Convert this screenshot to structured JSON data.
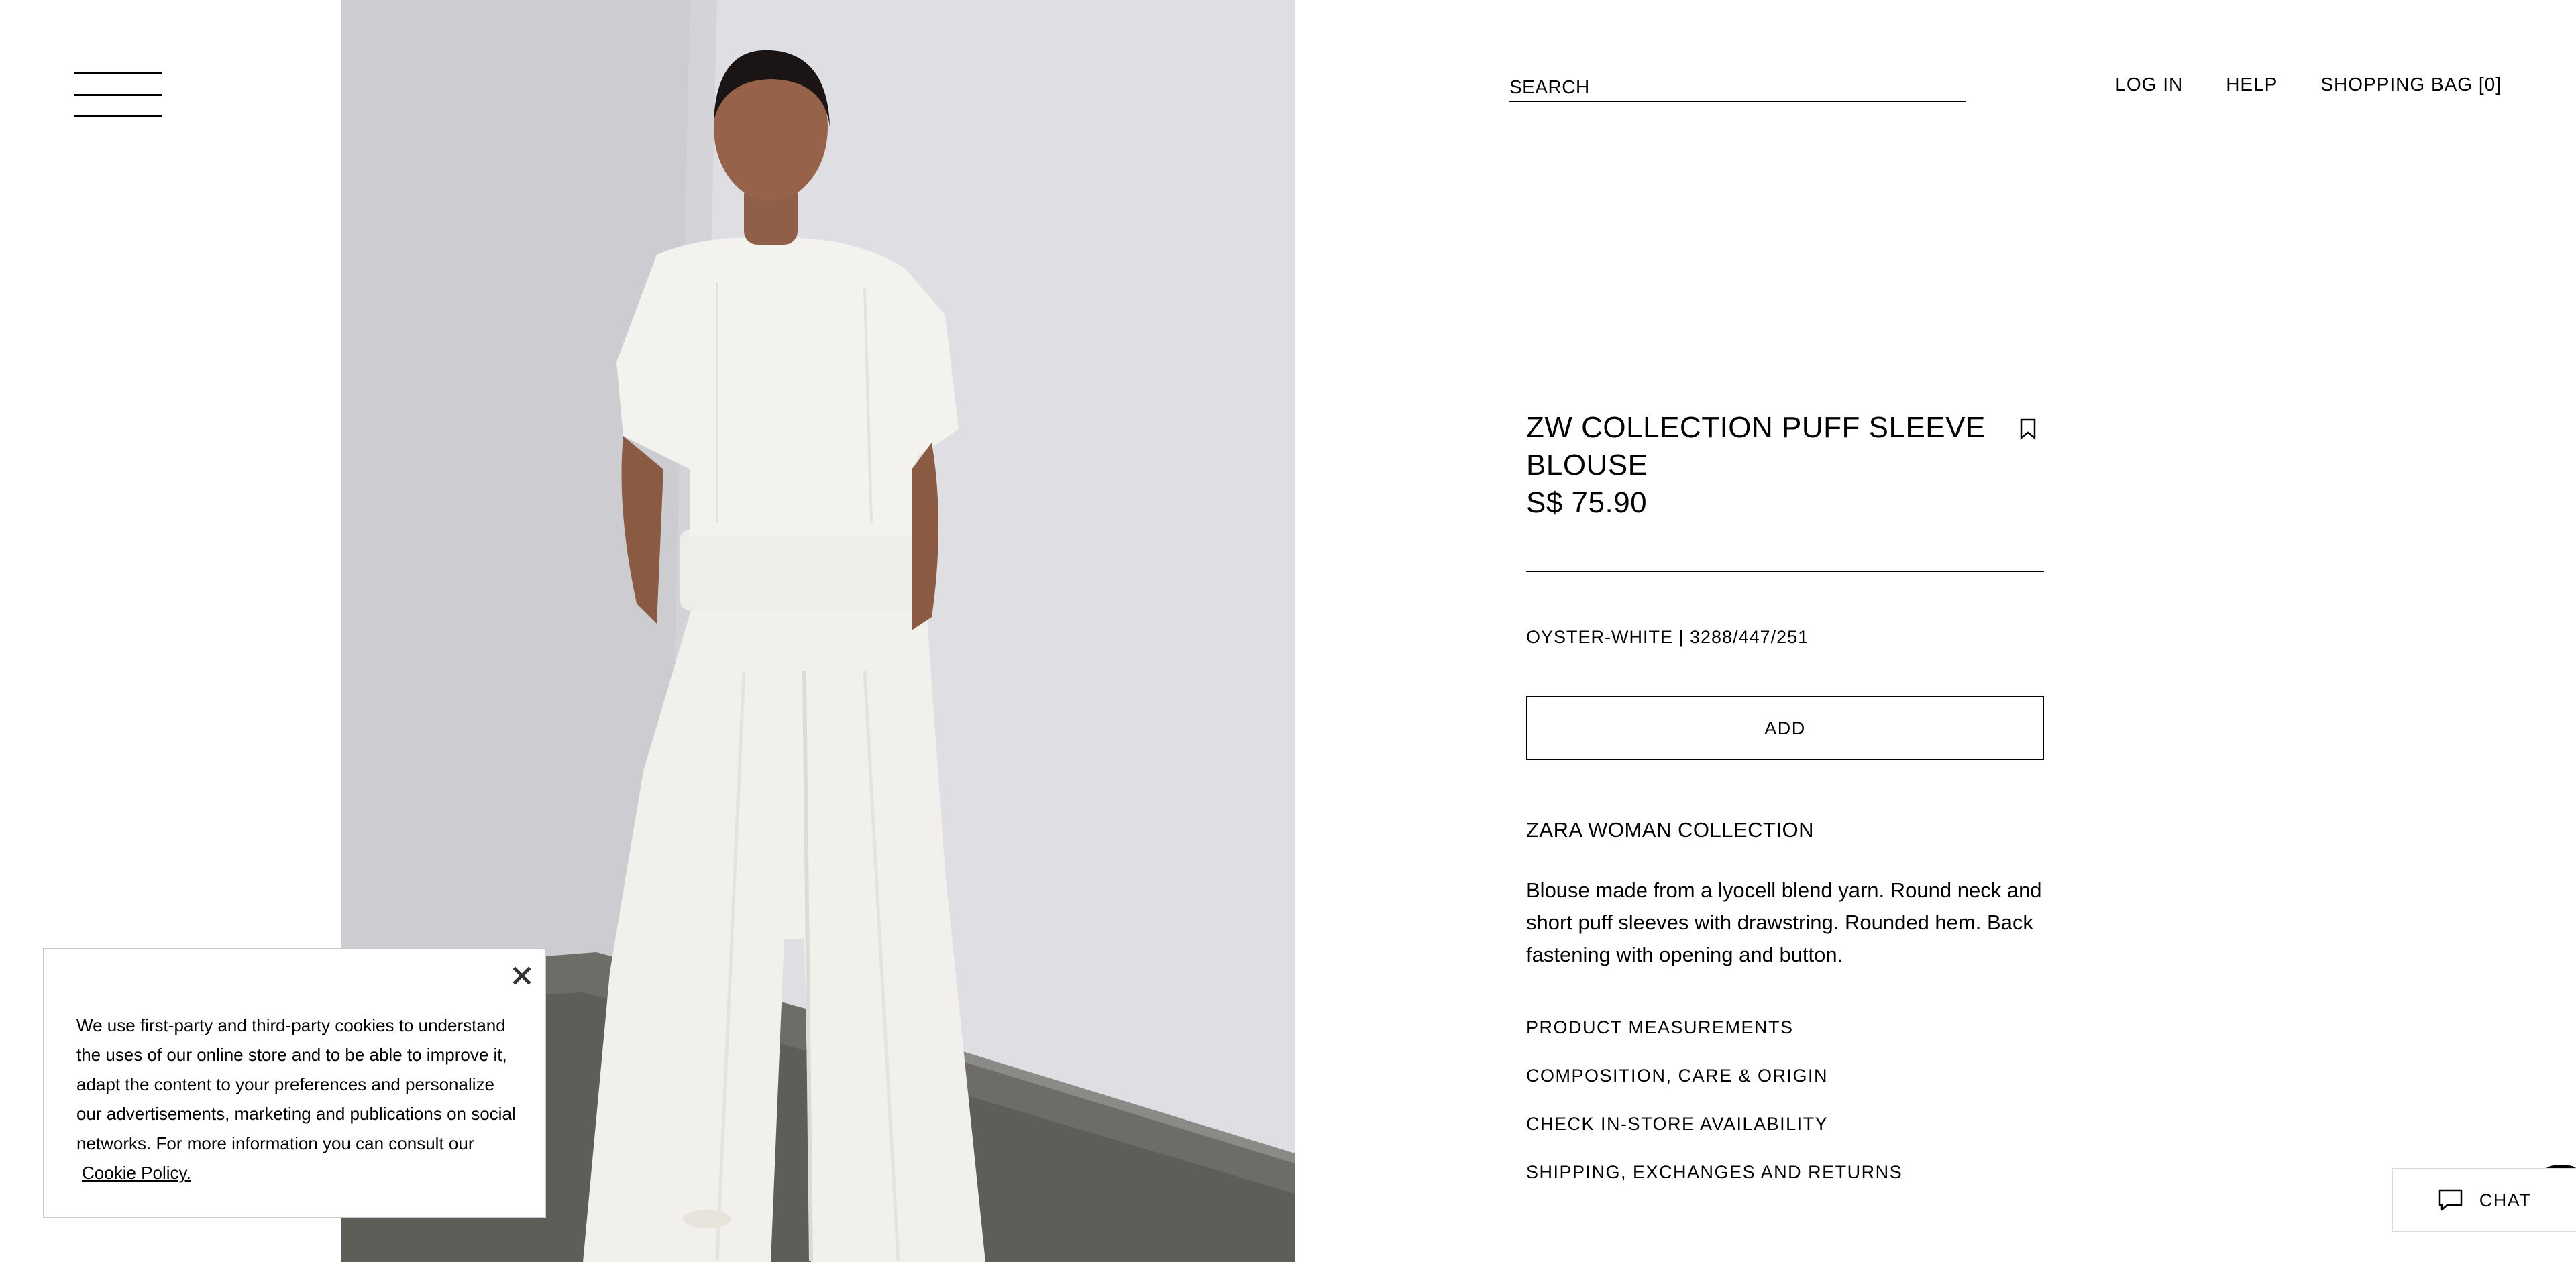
{
  "header": {
    "menu_icon": "hamburger-menu-icon",
    "search_placeholder": "SEARCH",
    "nav": {
      "login": "LOG IN",
      "help": "HELP",
      "bag": "SHOPPING BAG [0]"
    }
  },
  "product": {
    "name": "ZW COLLECTION PUFF SLEEVE BLOUSE",
    "price": "S$ 75.90",
    "color_ref": "OYSTER-WHITE | 3288/447/251",
    "add_label": "ADD",
    "bookmark_icon": "bookmark-icon",
    "collection": "ZARA WOMAN COLLECTION",
    "description": "Blouse made from a lyocell blend yarn. Round neck and short puff sleeves with drawstring. Rounded hem. Back fastening with opening and button.",
    "links": [
      "PRODUCT MEASUREMENTS",
      "COMPOSITION, CARE & ORIGIN",
      "CHECK IN-STORE AVAILABILITY",
      "SHIPPING, EXCHANGES AND RETURNS"
    ]
  },
  "cookie_banner": {
    "text": "We use first-party and third-party cookies to understand the uses of our online store and to be able to improve it, adapt the content to your preferences and personalize our advertisements, marketing and publications on social networks. For more information you can consult our",
    "link": "Cookie Policy.",
    "close_icon": "close-icon"
  },
  "chat": {
    "label": "CHAT",
    "icon": "chat-bubble-icon"
  },
  "colors": {
    "text": "#000000",
    "background": "#ffffff",
    "photo_wall": "#d9d9dd",
    "floor": "#6d6c66",
    "garment": "#f1f0ec"
  }
}
